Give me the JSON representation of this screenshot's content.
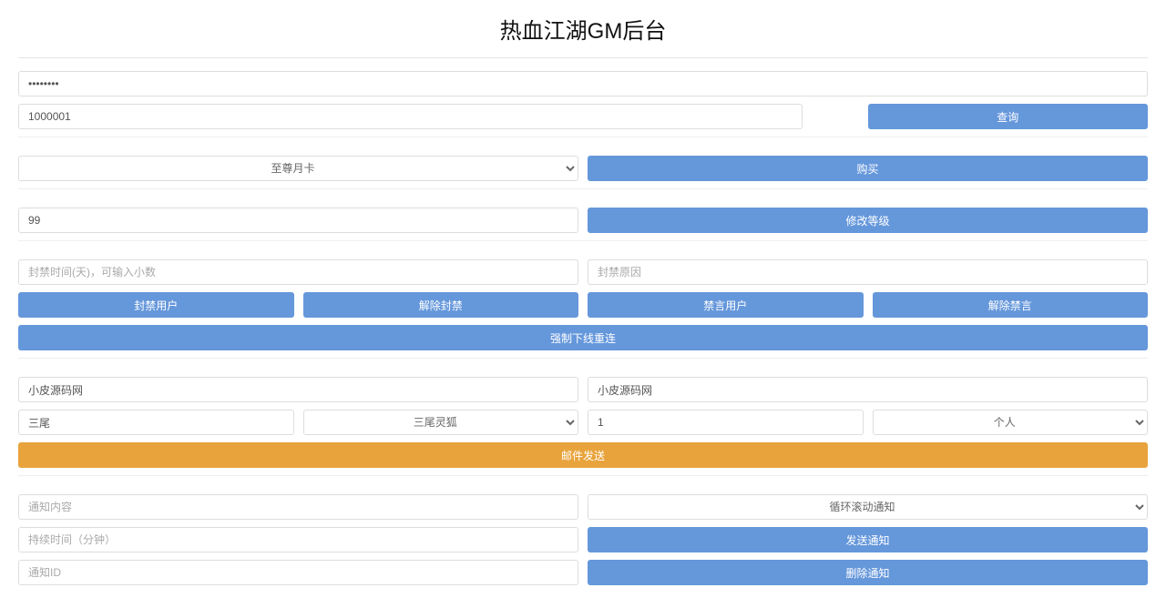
{
  "title": "热血江湖GM后台",
  "auth": {
    "password_value": "••••••••",
    "account_value": "1000001",
    "query_label": "查询"
  },
  "card": {
    "select_value": "至尊月卡",
    "buy_label": "购买"
  },
  "level": {
    "value": "99",
    "modify_label": "修改等级"
  },
  "ban": {
    "time_placeholder": "封禁时间(天)，可输入小数",
    "reason_placeholder": "封禁原因",
    "ban_user_label": "封禁用户",
    "unban_label": "解除封禁",
    "mute_user_label": "禁言用户",
    "unmute_label": "解除禁言",
    "force_offline_label": "强制下线重连"
  },
  "mail": {
    "title_value": "小皮源码网",
    "content_value": "小皮源码网",
    "item_search_value": "三尾",
    "item_select_value": "三尾灵狐",
    "count_value": "1",
    "target_select_value": "个人",
    "send_label": "邮件发送"
  },
  "notify": {
    "content_placeholder": "通知内容",
    "type_select_value": "循环滚动通知",
    "duration_placeholder": "持续时间（分钟）",
    "send_label": "发送通知",
    "id_placeholder": "通知ID",
    "delete_label": "删除通知"
  }
}
